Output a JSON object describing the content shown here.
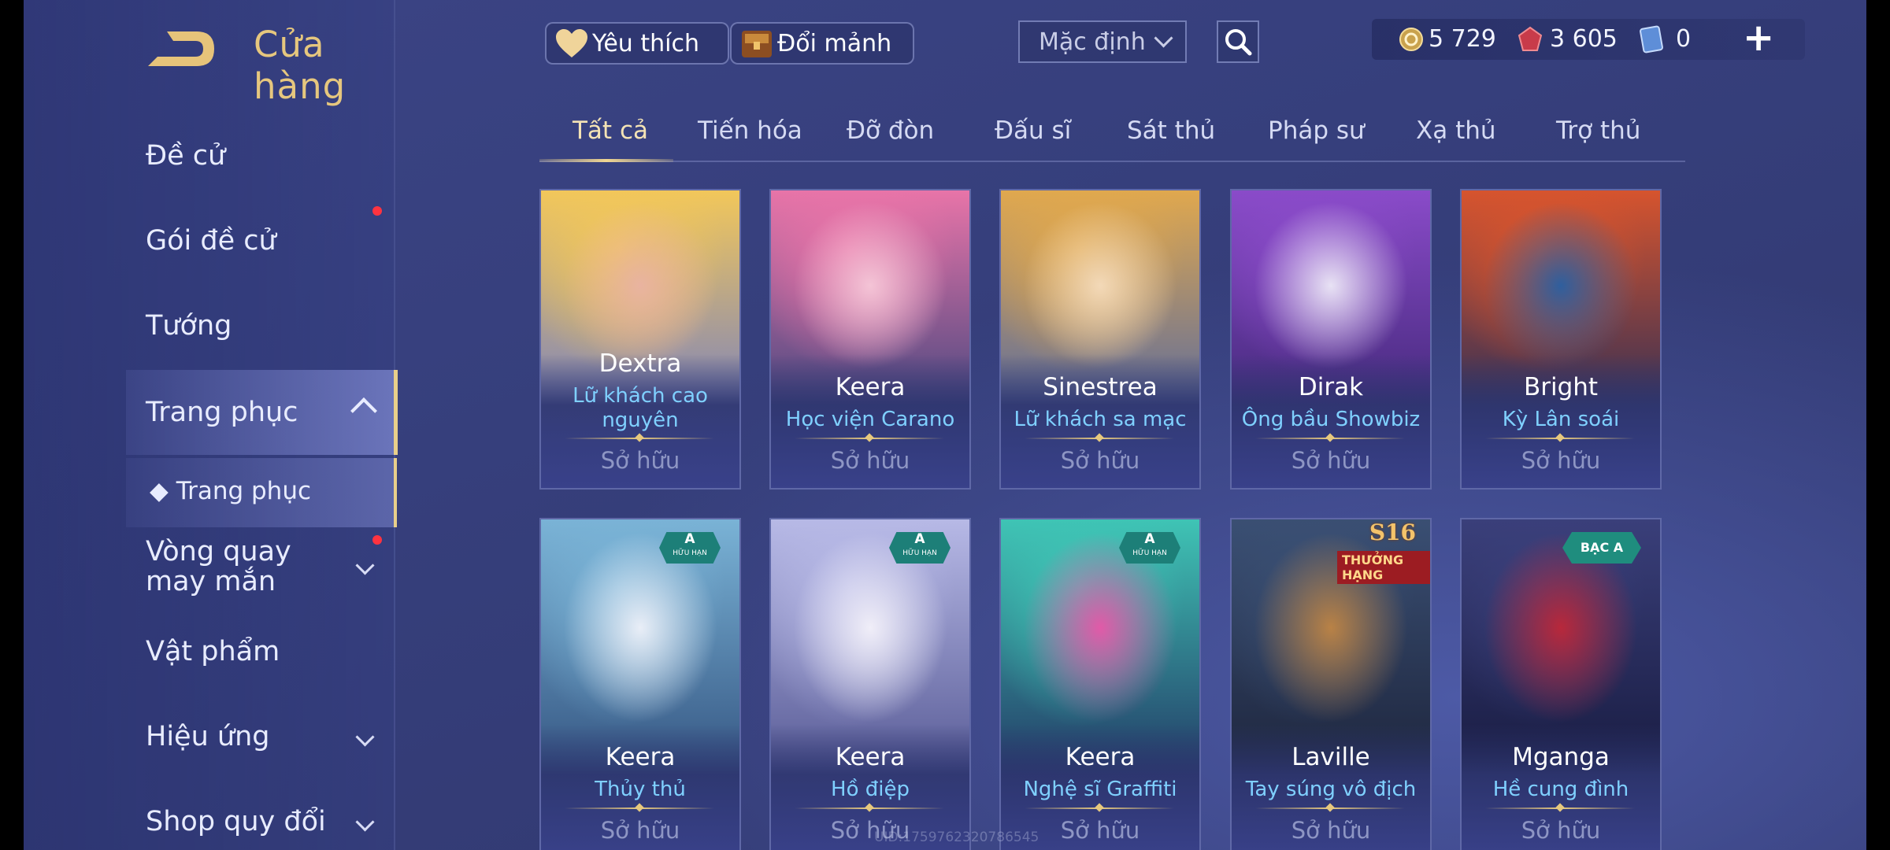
{
  "header": {
    "title": "Cửa hàng",
    "favorite_label": "Yêu thích",
    "exchange_label": "Đổi mảnh",
    "sort_value": "Mặc định",
    "currencies": [
      {
        "icon": "gold-coin-icon",
        "value": "5 729"
      },
      {
        "icon": "red-gem-icon",
        "value": "3 605"
      },
      {
        "icon": "blue-card-icon",
        "value": "0"
      }
    ]
  },
  "sidebar": {
    "items": [
      {
        "label": "Đề cử"
      },
      {
        "label": "Gói đề cử"
      },
      {
        "label": "Tướng"
      },
      {
        "label": "Trang phục"
      },
      {
        "label": "Trang phục"
      },
      {
        "label": "Vòng quay may mắn"
      },
      {
        "label": "Vật phẩm"
      },
      {
        "label": "Hiệu ứng"
      },
      {
        "label": "Shop quy đổi"
      }
    ]
  },
  "tabs": [
    "Tất cả",
    "Tiến hóa",
    "Đỡ đòn",
    "Đấu sĩ",
    "Sát thủ",
    "Pháp sư",
    "Xạ thủ",
    "Trợ thủ"
  ],
  "cards": [
    {
      "hero": "Dextra",
      "skin": "Lữ khách cao nguyên",
      "status": "Sở hữu",
      "colors": [
        "#f2c75a",
        "#e9b3a0",
        "#6c79c9"
      ]
    },
    {
      "hero": "Keera",
      "skin": "Học viện Carano",
      "status": "Sở hữu",
      "colors": [
        "#e874a8",
        "#f4c4d6",
        "#32417a"
      ]
    },
    {
      "hero": "Sinestrea",
      "skin": "Lữ khách sa mạc",
      "status": "Sở hữu",
      "colors": [
        "#e0a84e",
        "#f3d9b8",
        "#4a63a8"
      ]
    },
    {
      "hero": "Dirak",
      "skin": "Ông bầu Showbiz",
      "status": "Sở hữu",
      "colors": [
        "#8a4bc9",
        "#e8e2f4",
        "#3a2470"
      ]
    },
    {
      "hero": "Bright",
      "skin": "Kỳ Lân soái",
      "status": "Sở hữu",
      "colors": [
        "#d6542e",
        "#2f5f9e",
        "#1d2a5a"
      ]
    },
    {
      "hero": "Keera",
      "skin": "Thủy thủ",
      "status": "Sở hữu",
      "colors": [
        "#7ab3d6",
        "#e9eef7",
        "#2c4a78"
      ],
      "badge": {
        "main": "A",
        "sub": "HỮU HẠN"
      }
    },
    {
      "hero": "Keera",
      "skin": "Hồ điệp",
      "status": "Sở hữu",
      "colors": [
        "#b7b9e6",
        "#f0eef8",
        "#4c4f8c"
      ],
      "badge": {
        "main": "A",
        "sub": "HỮU HẠN"
      }
    },
    {
      "hero": "Keera",
      "skin": "Nghệ sĩ Graffiti",
      "status": "Sở hữu",
      "colors": [
        "#3fc4b5",
        "#e15aa8",
        "#1f2a5c"
      ],
      "badge": {
        "main": "A",
        "sub": "HỮU HẠN"
      }
    },
    {
      "hero": "Laville",
      "skin": "Tay súng vô địch",
      "status": "Sở hữu",
      "colors": [
        "#3a4f73",
        "#b98246",
        "#1a2036"
      ],
      "badge_s16": {
        "main": "S16",
        "sub": "THƯỞNG HẠNG"
      }
    },
    {
      "hero": "Mganga",
      "skin": "Hề cung đình",
      "status": "Sở hữu",
      "colors": [
        "#3a3f7a",
        "#b8283b",
        "#14173a"
      ],
      "badge": {
        "main": "BẠC A",
        "sub": ""
      }
    }
  ],
  "watermark": "UID:1759762320786545"
}
